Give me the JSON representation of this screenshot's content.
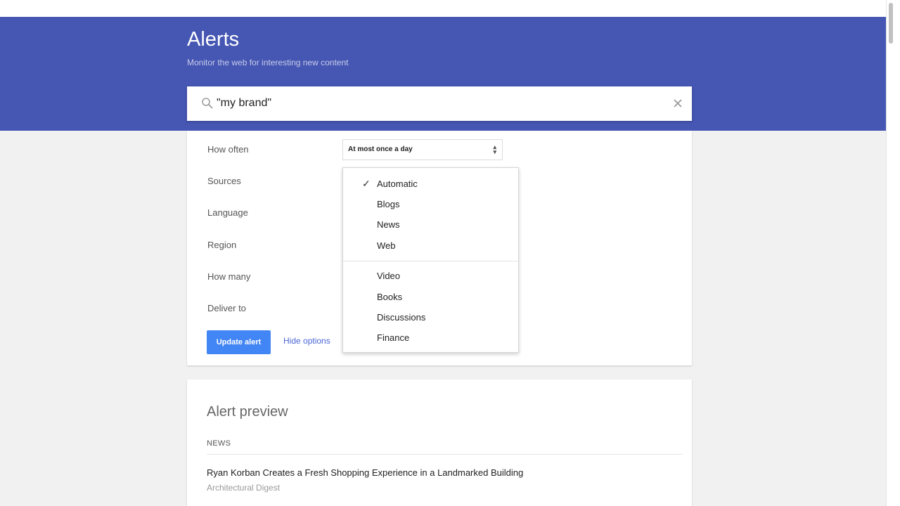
{
  "header": {
    "title": "Alerts",
    "subtitle": "Monitor the web for interesting new content"
  },
  "search": {
    "value": "\"my brand\"",
    "search_icon": "search-icon",
    "clear_icon": "close-icon"
  },
  "options": {
    "how_often_label": "How often",
    "how_often_value": "At most once a day",
    "sources_label": "Sources",
    "language_label": "Language",
    "region_label": "Region",
    "how_many_label": "How many",
    "deliver_to_label": "Deliver to",
    "update_button": "Update alert",
    "hide_options": "Hide options"
  },
  "sources_dropdown": {
    "selected_mark": "✓",
    "items": [
      "Automatic",
      "Blogs",
      "News",
      "Web",
      "Video",
      "Books",
      "Discussions",
      "Finance"
    ]
  },
  "preview": {
    "title": "Alert preview",
    "section": "NEWS",
    "article_title": "Ryan Korban Creates a Fresh Shopping Experience in a Landmarked Building",
    "article_source": "Architectural Digest"
  },
  "colors": {
    "header": "#4556b3",
    "button": "#4285f4",
    "link": "#4a66d8"
  }
}
